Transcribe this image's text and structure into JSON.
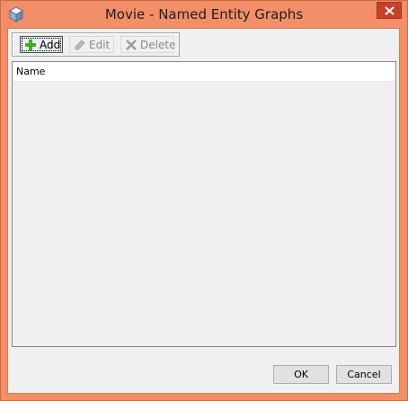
{
  "window": {
    "title": "Movie - Named Entity Graphs"
  },
  "toolbar": {
    "add_label": "Add",
    "edit_label": "Edit",
    "delete_label": "Delete"
  },
  "table": {
    "columns": [
      "Name"
    ],
    "rows": []
  },
  "footer": {
    "ok_label": "OK",
    "cancel_label": "Cancel"
  },
  "icons": {
    "app": "cube-icon",
    "add": "plus-icon",
    "edit": "pencil-icon",
    "delete": "x-icon",
    "close": "close-icon"
  },
  "colors": {
    "window_frame": "#f28f68",
    "close_button": "#c7402b",
    "client_bg": "#f0f0f0",
    "add_icon": "#3fae29"
  }
}
